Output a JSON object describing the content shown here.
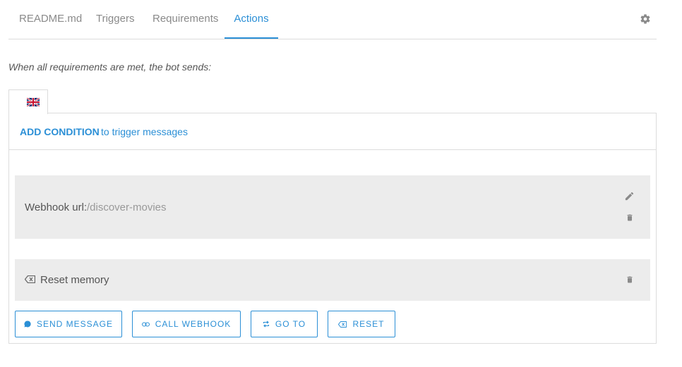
{
  "tabs": [
    {
      "label": "README.md"
    },
    {
      "label": "Triggers"
    },
    {
      "label": "Requirements"
    },
    {
      "label": "Actions",
      "active": true
    }
  ],
  "settings_icon": "gear-icon",
  "intro_text": "When all requirements are met, the bot sends:",
  "language": {
    "icon": "uk-flag-icon"
  },
  "condition": {
    "add_label": "ADD CONDITION",
    "hint": "to trigger messages"
  },
  "actions": [
    {
      "type": "webhook",
      "label": "Webhook url:",
      "value": "/discover-movies"
    },
    {
      "type": "reset",
      "label": "Reset memory"
    }
  ],
  "buttons": {
    "send_message": "SEND MESSAGE",
    "call_webhook": "CALL WEBHOOK",
    "go_to": "GO TO",
    "reset": "RESET"
  },
  "colors": {
    "accent": "#2b8fd6",
    "block_bg": "#ececec",
    "border": "#dcdcdc"
  }
}
